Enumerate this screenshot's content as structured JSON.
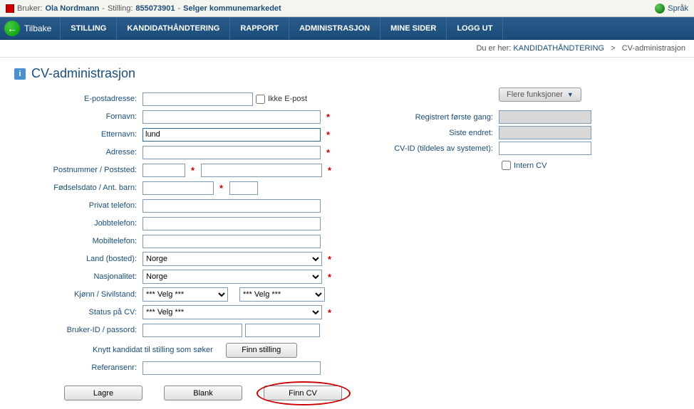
{
  "header": {
    "bruker_label": "Bruker:",
    "bruker_value": "Ola Nordmann",
    "stilling_label": "Stilling:",
    "stilling_id": "855073901",
    "stilling_title": "Selger kommunemarkedet",
    "sprak": "Språk"
  },
  "nav": {
    "back": "Tilbake",
    "items": [
      "STILLING",
      "KANDIDATHÅNDTERING",
      "RAPPORT",
      "ADMINISTRASJON",
      "MINE SIDER",
      "LOGG UT"
    ]
  },
  "breadcrumb": {
    "prefix": "Du er her:",
    "link": "KANDIDATHÅNDTERING",
    "sep": ">",
    "current": "CV-administrasjon"
  },
  "page": {
    "title": "CV-administrasjon"
  },
  "form": {
    "epost_label": "E-postadresse:",
    "ikke_epost": "Ikke E-post",
    "fornavn_label": "Fornavn:",
    "etternavn_label": "Etternavn:",
    "etternavn_value": "lund",
    "adresse_label": "Adresse:",
    "postnr_label": "Postnummer / Poststed:",
    "fodsel_label": "Fødselsdato / Ant. barn:",
    "privat_tel_label": "Privat telefon:",
    "jobb_tel_label": "Jobbtelefon:",
    "mobil_tel_label": "Mobiltelefon:",
    "land_label": "Land (bosted):",
    "land_value": "Norge",
    "nasjonalitet_label": "Nasjonalitet:",
    "nasjonalitet_value": "Norge",
    "kjonn_label": "Kjønn / Sivilstand:",
    "velg_option": "*** Velg ***",
    "status_label": "Status på CV:",
    "bruker_id_label": "Bruker-ID / passord:",
    "knytt_label": "Knytt kandidat til stilling som søker",
    "finn_stilling_btn": "Finn stilling",
    "referansenr_label": "Referansenr:"
  },
  "actions": {
    "lagre": "Lagre",
    "blank": "Blank",
    "finn_cv": "Finn CV"
  },
  "right": {
    "flere_funksjoner": "Flere funksjoner",
    "registrert_label": "Registrert første gang:",
    "siste_endret_label": "Siste endret:",
    "cvid_label": "CV-ID (tildeles av systemet):",
    "intern_cv": "Intern CV"
  }
}
